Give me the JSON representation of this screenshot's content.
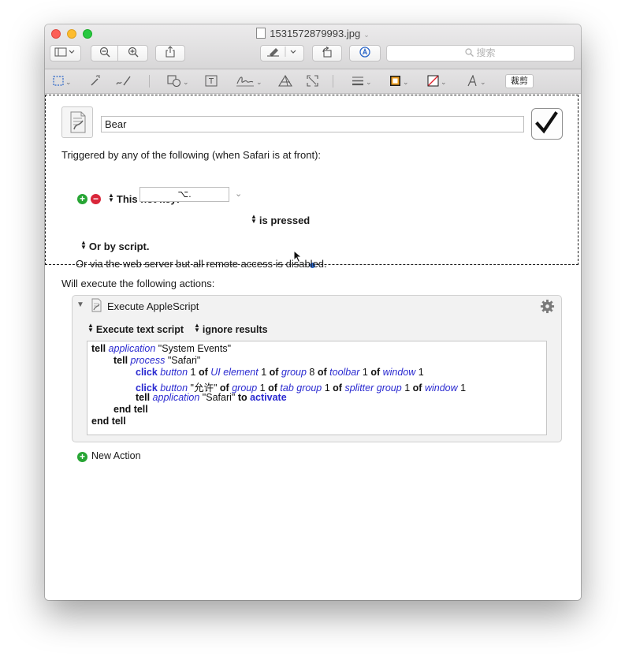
{
  "window": {
    "title": "1531572879993.jpg",
    "search_placeholder": "搜索"
  },
  "markup": {
    "crop_label": "裁剪"
  },
  "macro": {
    "name": "Bear",
    "trigger_heading": "Triggered by any of the following (when Safari is at front):",
    "hot_key_label": "This hot key:",
    "hot_key_value": "⌥.",
    "hot_key_state": "is pressed",
    "or_by_script": "Or by script.",
    "web_server_note": "Or via the web server but all remote access is disabled.",
    "actions_heading": "Will execute the following actions:"
  },
  "action": {
    "title": "Execute AppleScript",
    "mode_option": "Execute text script",
    "results_option": "ignore results",
    "script": {
      "l1": {
        "a": "tell",
        "b": "application",
        "c": "\"System Events\""
      },
      "l2": {
        "a": "tell",
        "b": "process",
        "c": "\"Safari\""
      },
      "l3": {
        "a": "click",
        "b": "button",
        "c": "1",
        "d": "of",
        "e": "UI element",
        "f": "1",
        "g": "of",
        "h": "group",
        "i": "8",
        "j": "of",
        "k": "toolbar",
        "l": "1",
        "m": "of",
        "n": "window",
        "o": "1"
      },
      "l4": {
        "a": "click",
        "b": "button",
        "c": "\"允许\"",
        "d": "of",
        "e": "group",
        "f": "1",
        "g": "of",
        "h": "tab group",
        "i": "1",
        "j": "of",
        "k": "splitter group",
        "l": "1",
        "m": "of",
        "n": "window",
        "o": "1"
      },
      "l5": {
        "a": "tell",
        "b": "application",
        "c": "\"Safari\"",
        "d": "to",
        "e": "activate"
      },
      "l6": {
        "a": "end tell"
      },
      "l7": {
        "a": "end tell"
      }
    }
  },
  "new_action_label": "New Action",
  "colors": {
    "accent_blue": "#2b66c8",
    "add_green": "#27a534",
    "remove_red": "#d9263a",
    "script_keyword_blue": "#2a2ad0"
  }
}
